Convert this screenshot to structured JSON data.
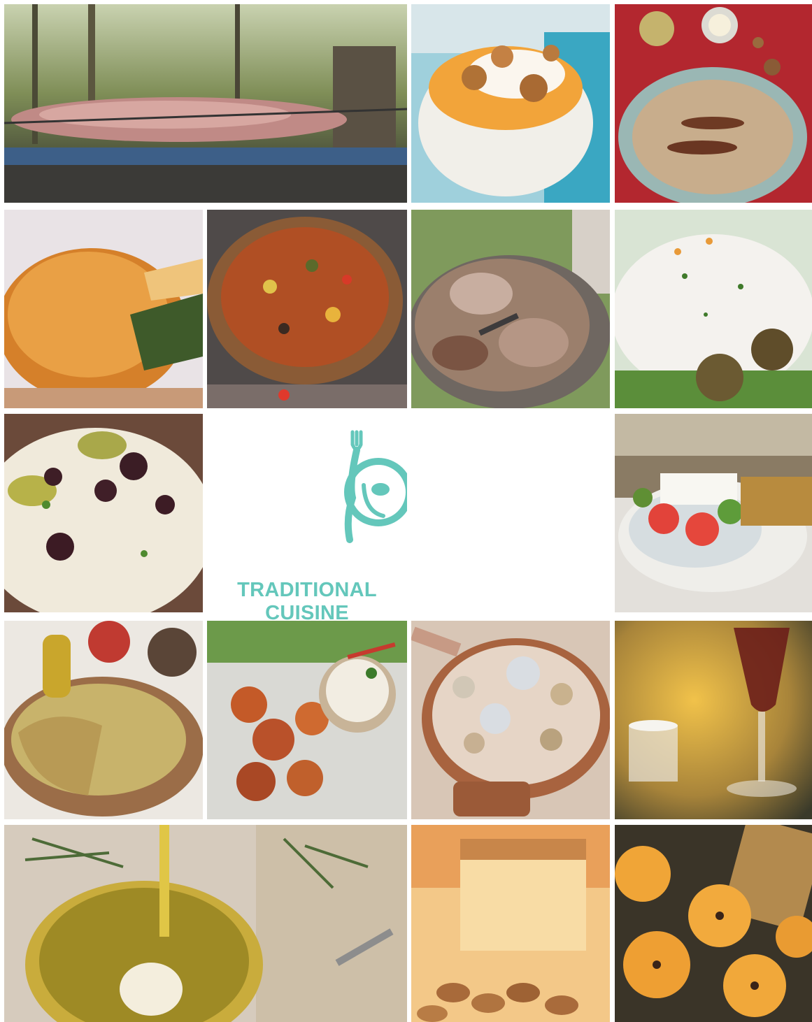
{
  "brand": {
    "title": "TRADITIONAL CUISINE",
    "accent_color": "#64c7bb",
    "logo_icon": "plate-fork-spoon-icon"
  },
  "tiles": [
    {
      "name": "spit-roast-lamb",
      "subject": "whole lamb roasting on a spit over charcoal in a forest"
    },
    {
      "name": "yogurt-walnuts-honey",
      "subject": "bowl of yogurt with walnuts and honey"
    },
    {
      "name": "kebabs-on-platter",
      "subject": "grilled kebabs on a plate with yogurt and nuts"
    },
    {
      "name": "spinach-pie",
      "subject": "flaky phyllo spinach pie"
    },
    {
      "name": "vegetable-stew-pot",
      "subject": "clay pot of vegetable stew over fire"
    },
    {
      "name": "roast-meat-platter",
      "subject": "platter of roasted meat"
    },
    {
      "name": "cream-cheese-dip",
      "subject": "creamy cheese dip with olives and herbs"
    },
    {
      "name": "olive-feta-dish",
      "subject": "feta with black and green olives"
    },
    {
      "name": "greek-salad",
      "subject": "greek salad with feta at a seaside table"
    },
    {
      "name": "corn-bread-pie",
      "subject": "baked pie with olive oil and peppers"
    },
    {
      "name": "roasted-cauliflower",
      "subject": "roasted spiced cauliflower with yogurt dip"
    },
    {
      "name": "dumplings-board",
      "subject": "dumplings with dips on a wooden board"
    },
    {
      "name": "wine-and-ouzo",
      "subject": "glass of red wine and a shot glass"
    },
    {
      "name": "olive-oil-jar",
      "subject": "herb-infused olive oil pouring into a jar"
    },
    {
      "name": "almond-dessert",
      "subject": "baked almond dessert"
    },
    {
      "name": "spiced-mandarins",
      "subject": "mandarins with cloves in syrup"
    }
  ]
}
